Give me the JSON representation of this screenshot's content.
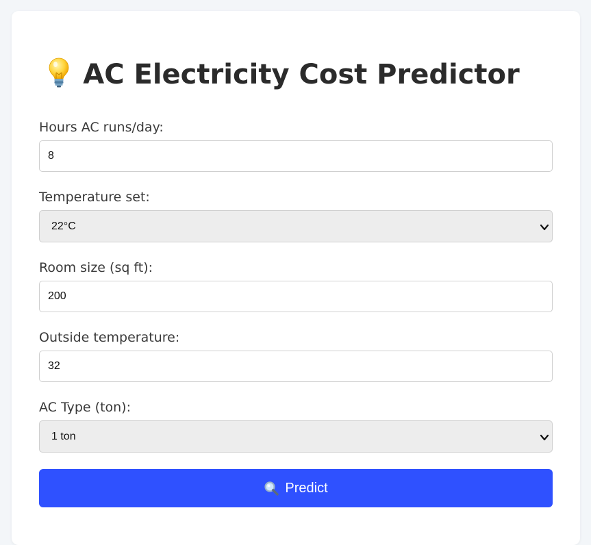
{
  "page": {
    "title": "AC Electricity Cost Predictor",
    "title_icon": "lightbulb-icon"
  },
  "form": {
    "hours": {
      "label": "Hours AC runs/day:",
      "value": "8"
    },
    "temperature": {
      "label": "Temperature set:",
      "selected": "22°C"
    },
    "room_size": {
      "label": "Room size (sq ft):",
      "value": "200"
    },
    "outside_temp": {
      "label": "Outside temperature:",
      "value": "32"
    },
    "ac_type": {
      "label": "AC Type (ton):",
      "selected": "1 ton"
    }
  },
  "predict_button": {
    "label": "Predict",
    "icon": "search-icon"
  },
  "colors": {
    "page_background": "#f3f6f9",
    "card_background": "#ffffff",
    "accent": "#2f51ff",
    "select_background": "#ededed",
    "text": "#2b2b2b"
  }
}
